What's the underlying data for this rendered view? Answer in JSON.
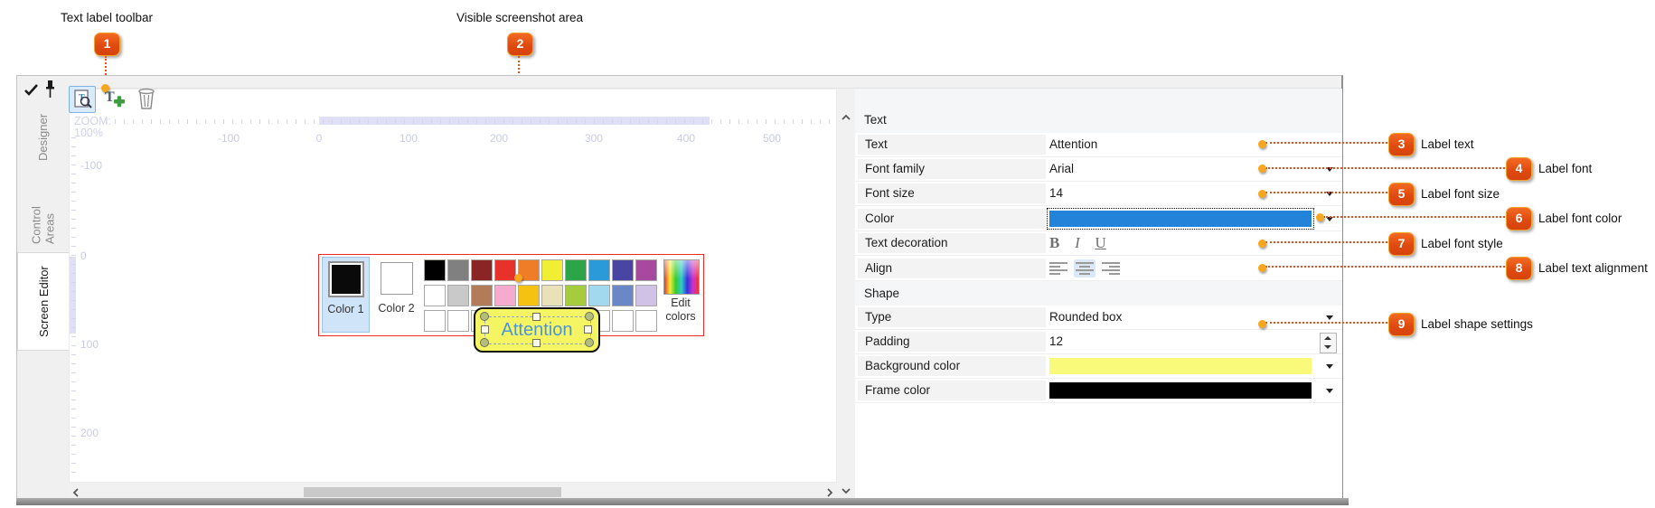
{
  "callouts": {
    "top": [
      {
        "num": "1",
        "label": "Text label toolbar"
      },
      {
        "num": "2",
        "label": "Visible screenshot area"
      }
    ],
    "right": [
      {
        "num": "3",
        "label": "Label text"
      },
      {
        "num": "4",
        "label": "Label font"
      },
      {
        "num": "5",
        "label": "Label font size"
      },
      {
        "num": "6",
        "label": "Label font color"
      },
      {
        "num": "7",
        "label": "Label font style"
      },
      {
        "num": "8",
        "label": "Label text alignment"
      },
      {
        "num": "9",
        "label": "Label shape settings"
      }
    ]
  },
  "sidebar": {
    "tabs": [
      {
        "label": "Designer",
        "active": false
      },
      {
        "label": "Control Areas",
        "active": false
      },
      {
        "label": "Screen Editor",
        "active": true
      }
    ]
  },
  "toolbar": {
    "icons": [
      "preview-text-labels",
      "add-text-label",
      "delete-text-label"
    ]
  },
  "canvas": {
    "zoom_label": "ZOOM:",
    "zoom_value": "100%",
    "h_ruler": [
      "-100",
      "0",
      "100",
      "200",
      "300",
      "400",
      "500"
    ],
    "v_ruler": [
      "-100",
      "0",
      "100",
      "200"
    ],
    "palette": {
      "color1_label": "Color 1",
      "color2_label": "Color 2",
      "edit_label": "Edit colors",
      "row1": [
        "#000000",
        "#808080",
        "#8b2424",
        "#e8312b",
        "#ef7d28",
        "#f1ee33",
        "#2ba547",
        "#2b9ad8",
        "#4846a2",
        "#a8489e"
      ],
      "row2": [
        "#ffffff",
        "#c9c9c9",
        "#b27c58",
        "#f4abce",
        "#f5c211",
        "#e9e2b8",
        "#a6cb3c",
        "#a2d9ee",
        "#6a88c8",
        "#cfc2e6"
      ],
      "row3": [
        "#ffffff",
        "#ffffff",
        "#ffffff",
        "#ffffff",
        "#ffffff",
        "#ffffff",
        "#ffffff",
        "#ffffff",
        "#ffffff",
        "#ffffff"
      ]
    },
    "label": {
      "text": "Attention",
      "background": "#f5f563",
      "text_color": "#4b97d5"
    }
  },
  "properties": {
    "text_section": "Text",
    "shape_section": "Shape",
    "rows": {
      "text": {
        "label": "Text",
        "value": "Attention"
      },
      "font_family": {
        "label": "Font family",
        "value": "Arial"
      },
      "font_size": {
        "label": "Font size",
        "value": "14"
      },
      "color": {
        "label": "Color",
        "value": "#2283d8"
      },
      "text_decoration": {
        "label": "Text decoration",
        "options": [
          "B",
          "I",
          "U"
        ]
      },
      "align": {
        "label": "Align"
      },
      "type": {
        "label": "Type",
        "value": "Rounded box"
      },
      "padding": {
        "label": "Padding",
        "value": "12"
      },
      "background_color": {
        "label": "Background color",
        "value": "#f9f97a"
      },
      "frame_color": {
        "label": "Frame color",
        "value": "#000000"
      }
    }
  }
}
